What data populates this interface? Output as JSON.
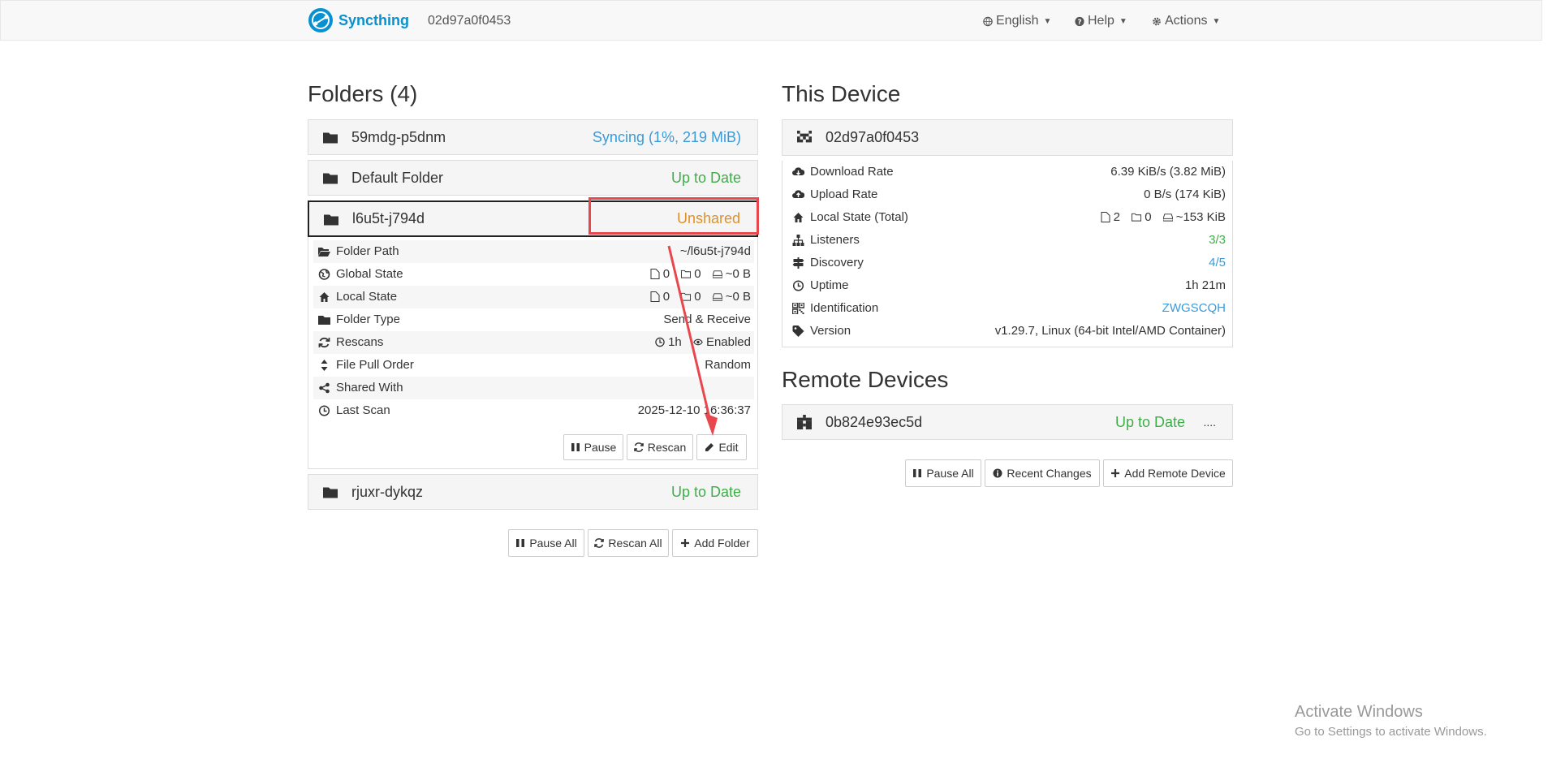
{
  "navbar": {
    "brand": "Syncthing",
    "device_id": "02d97a0f0453",
    "language": "English",
    "help": "Help",
    "actions": "Actions"
  },
  "folders": {
    "title": "Folders (4)",
    "items": [
      {
        "name": "59mdg-p5dnm",
        "status": "Syncing (1%, 219 MiB)",
        "status_color": "#3a9ad9"
      },
      {
        "name": "Default Folder",
        "status": "Up to Date",
        "status_color": "#3fae49"
      },
      {
        "name": "l6u5t-j794d",
        "status": "Unshared",
        "status_color": "#e1902a"
      },
      {
        "name": "rjuxr-dykqz",
        "status": "Up to Date",
        "status_color": "#3fae49"
      }
    ],
    "expanded": {
      "folder_path_label": "Folder Path",
      "folder_path_value": "~/l6u5t-j794d",
      "global_state_label": "Global State",
      "global_files": "0",
      "global_dirs": "0",
      "global_size": "~0 B",
      "local_state_label": "Local State",
      "local_files": "0",
      "local_dirs": "0",
      "local_size": "~0 B",
      "folder_type_label": "Folder Type",
      "folder_type_value": "Send & Receive",
      "rescans_label": "Rescans",
      "rescans_interval": "1h",
      "rescans_watch": "Enabled",
      "pull_order_label": "File Pull Order",
      "pull_order_value": "Random",
      "shared_with_label": "Shared With",
      "last_scan_label": "Last Scan",
      "last_scan_value": "2025-12-10 16:36:37",
      "pause_button": "Pause",
      "rescan_button": "Rescan",
      "edit_button": "Edit"
    },
    "pause_all": "Pause All",
    "rescan_all": "Rescan All",
    "add_folder": "Add Folder"
  },
  "this_device": {
    "title": "This Device",
    "name": "02d97a0f0453",
    "download_rate_label": "Download Rate",
    "download_rate_value": "6.39 KiB/s (3.82 MiB)",
    "upload_rate_label": "Upload Rate",
    "upload_rate_value": "0 B/s (174 KiB)",
    "local_state_label": "Local State (Total)",
    "local_files": "2",
    "local_dirs": "0",
    "local_size": "~153 KiB",
    "listeners_label": "Listeners",
    "listeners_value": "3/3",
    "discovery_label": "Discovery",
    "discovery_value": "4/5",
    "uptime_label": "Uptime",
    "uptime_value": "1h 21m",
    "identification_label": "Identification",
    "identification_value": "ZWGSCQH",
    "version_label": "Version",
    "version_value": "v1.29.7, Linux (64-bit Intel/AMD Container)"
  },
  "remote_devices": {
    "title": "Remote Devices",
    "items": [
      {
        "name": "0b824e93ec5d",
        "status": "Up to Date",
        "extra": "...."
      }
    ],
    "pause_all": "Pause All",
    "recent_changes": "Recent Changes",
    "add_remote": "Add Remote Device"
  },
  "watermark": {
    "line1": "Activate Windows",
    "line2": "Go to Settings to activate Windows."
  }
}
